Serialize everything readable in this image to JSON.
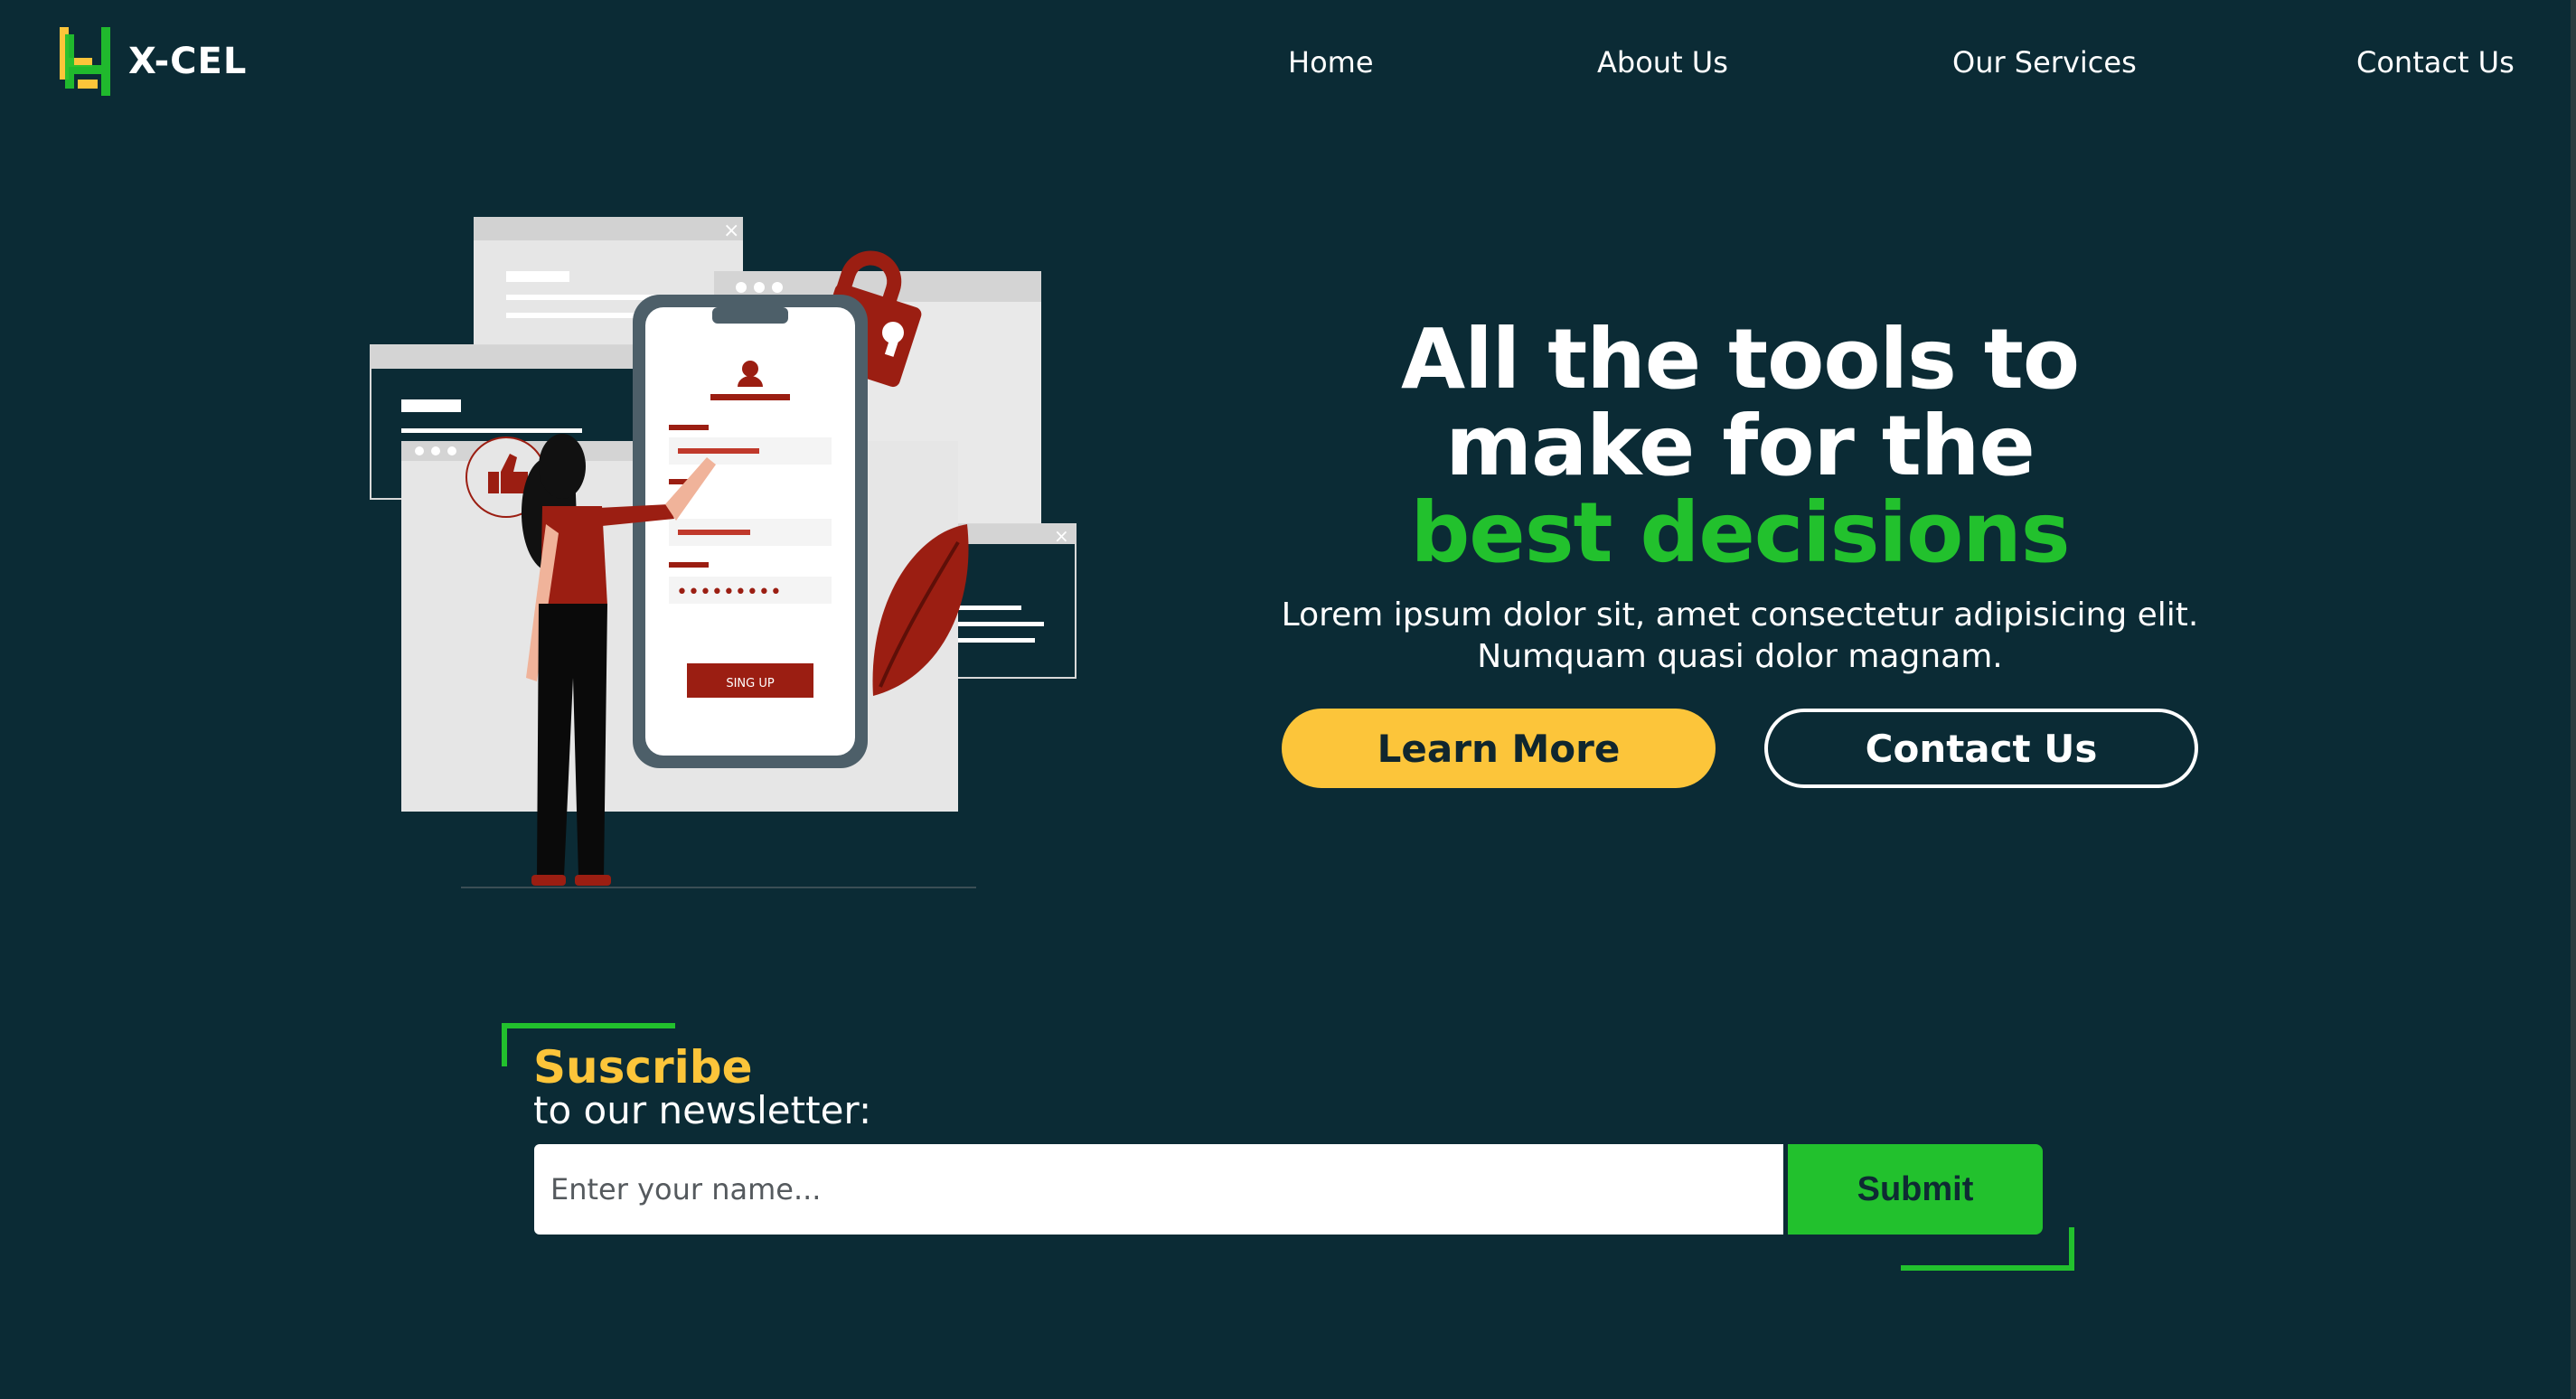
{
  "brand": {
    "name": "X-CEL",
    "logo_icon": "xcel-logo-icon",
    "accent_green": "#22c12d",
    "accent_yellow": "#fcc53a",
    "background": "#0b2b35"
  },
  "nav": {
    "items": [
      {
        "label": "Home"
      },
      {
        "label": "About Us"
      },
      {
        "label": "Our Services"
      },
      {
        "label": "Contact Us"
      }
    ]
  },
  "hero": {
    "line1": "All the tools to",
    "line2": "make for the",
    "highlight": "best decisions",
    "desc1": "Lorem ipsum dolor sit, amet consectetur adipisicing elit.",
    "desc2": "Numquam quasi dolor magnam.",
    "learn_more": "Learn More",
    "contact_us": "Contact Us"
  },
  "illustration": {
    "signup_button": "SING UP",
    "password_mask": "•••••••••"
  },
  "newsletter": {
    "title": "Suscribe",
    "subtitle": "to our newsletter:",
    "placeholder": "Enter your name...",
    "submit": "Submit"
  }
}
